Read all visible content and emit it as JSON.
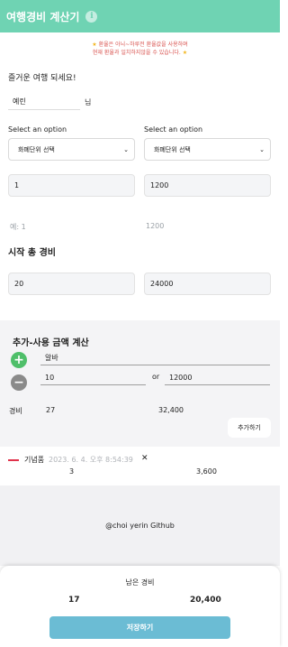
{
  "header": {
    "title": "여행경비 계산기",
    "info_icon": "i"
  },
  "notice": {
    "line1": "환율은 아늬~하루전 환율값을 사용하며",
    "line2": "현재 환율과 일치하지않을 수 있습니다."
  },
  "greeting": "즐거운 여행 되세요!",
  "name": {
    "value": "예린",
    "suffix": "님"
  },
  "currency": {
    "left": {
      "label": "Select an option",
      "selected": "화폐단위 선택"
    },
    "right": {
      "label": "Select an option",
      "selected": "화폐단위 선택"
    }
  },
  "rate": {
    "left": "1",
    "right": "1200"
  },
  "example": {
    "left": "예: 1",
    "right": "1200"
  },
  "start_budget": {
    "title": "시작 총 경비",
    "left": "20",
    "right": "24000"
  },
  "calc": {
    "title": "추가-사용 금액 계산",
    "item": "알바",
    "amount_left": "10",
    "or": "or",
    "amount_right": "12000",
    "result_label": "경비",
    "result_left": "27",
    "result_right": "32,400",
    "add_button": "추가하기"
  },
  "record": {
    "name": "기념품",
    "time": "2023. 6. 4. 오후 8:54:39",
    "delete": "✕",
    "left": "3",
    "right": "3,600"
  },
  "footer": {
    "credit": "@choi yerin Github"
  },
  "remaining": {
    "label": "남은 경비",
    "left": "17",
    "right": "20,400",
    "save_button": "저장하기"
  },
  "colors": {
    "header": "#6fd3b3",
    "save_button": "#6bbcd4",
    "record_dash": "#e0324b",
    "plus": "#4fbf6a"
  },
  "icons": {
    "info": "info-icon",
    "star": "star-icon",
    "plus": "plus-circle-icon",
    "minus": "minus-circle-icon",
    "chevron": "chevron-down-icon",
    "close": "close-icon"
  }
}
